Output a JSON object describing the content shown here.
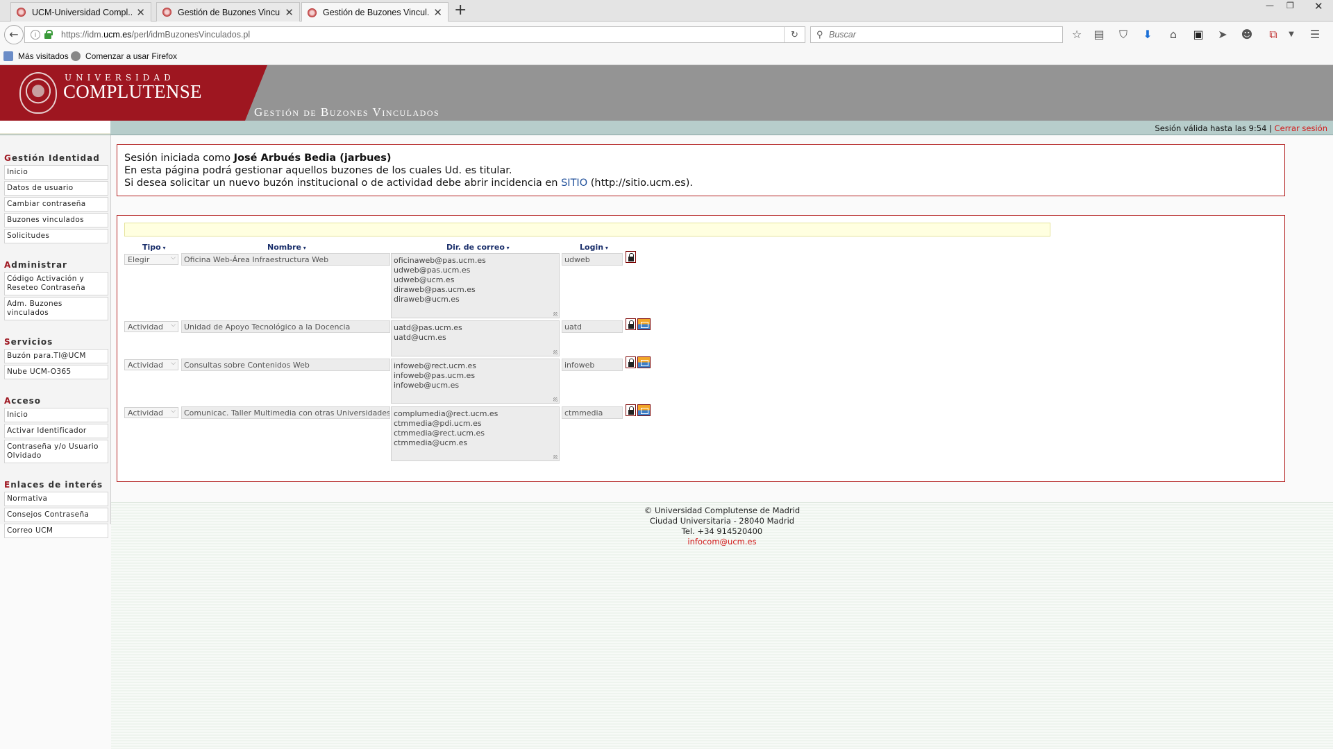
{
  "browser": {
    "tabs": [
      {
        "title": "UCM-Universidad Compl...",
        "active": false
      },
      {
        "title": "Gestión de Buzones Vincul...",
        "active": false
      },
      {
        "title": "Gestión de Buzones Vincul...",
        "active": true
      }
    ],
    "url": {
      "prefix": "https://idm.",
      "domain": "ucm.es",
      "path": "/perl/idmBuzonesVinculados.pl"
    },
    "search_placeholder": "Buscar",
    "bookmarks": [
      "Más visitados",
      "Comenzar a usar Firefox"
    ]
  },
  "header": {
    "logo_top": "UNIVERSIDAD",
    "logo_main": "COMPLUTENSE",
    "app_title": "Gestión de Buzones Vinculados",
    "session_text": "Sesión válida hasta las 9:54 |",
    "logout": "Cerrar sesión"
  },
  "sidebar": [
    {
      "first": "G",
      "rest": "estión Identidad",
      "items": [
        "Inicio",
        "Datos de usuario",
        "Cambiar contraseña",
        "Buzones vinculados",
        "Solicitudes"
      ]
    },
    {
      "first": "A",
      "rest": "dministrar",
      "items": [
        "Código Activación y Reseteo Contraseña",
        "Adm. Buzones vinculados"
      ]
    },
    {
      "first": "S",
      "rest": "ervicios",
      "items": [
        "Buzón para.TI@UCM",
        "Nube UCM-O365"
      ]
    },
    {
      "first": "A",
      "rest": "cceso",
      "items": [
        "Inicio",
        "Activar Identificador",
        "Contraseña y/o Usuario Olvidado"
      ]
    },
    {
      "first": "E",
      "rest": "nlaces de interés",
      "items": [
        "Normativa",
        "Consejos Contraseña",
        "Correo UCM"
      ]
    }
  ],
  "info": {
    "line1_prefix": "Sesión iniciada como ",
    "line1_user": "José Arbués Bedia (jarbues)",
    "line2": "En esta página podrá gestionar aquellos buzones de los cuales Ud. es titular.",
    "line3_prefix": "Si desea solicitar un nuevo buzón institucional o de actividad debe abrir incidencia en ",
    "line3_link": "SITIO",
    "line3_suffix": " (http://sitio.ucm.es)."
  },
  "table": {
    "headers": {
      "tipo": "Tipo",
      "nombre": "Nombre",
      "correo": "Dir. de correo",
      "login": "Login"
    },
    "rows": [
      {
        "tipo": "Elegir",
        "nombre": "Oficina Web-Área Infraestructura Web",
        "correos": [
          "oficinaweb@pas.ucm.es",
          "udweb@pas.ucm.es",
          "udweb@ucm.es",
          "diraweb@pas.ucm.es",
          "diraweb@ucm.es"
        ],
        "login": "udweb",
        "has_mail_icon": false
      },
      {
        "tipo": "Actividad",
        "nombre": "Unidad de Apoyo Tecnológico a la Docencia",
        "correos": [
          "uatd@pas.ucm.es",
          "uatd@ucm.es"
        ],
        "login": "uatd",
        "has_mail_icon": true
      },
      {
        "tipo": "Actividad",
        "nombre": "Consultas sobre Contenidos Web",
        "correos": [
          "infoweb@rect.ucm.es",
          "infoweb@pas.ucm.es",
          "infoweb@ucm.es"
        ],
        "login": "infoweb",
        "has_mail_icon": true
      },
      {
        "tipo": "Actividad",
        "nombre": "Comunicac. Taller Multimedia con otras Universidades",
        "correos": [
          "complumedia@rect.ucm.es",
          "ctmmedia@pdi.ucm.es",
          "ctmmedia@rect.ucm.es",
          "ctmmedia@ucm.es"
        ],
        "login": "ctmmedia",
        "has_mail_icon": true
      }
    ]
  },
  "footer": {
    "copyright": "© Universidad Complutense de Madrid",
    "address": "Ciudad Universitaria - 28040 Madrid",
    "phone": "Tel. +34 914520400",
    "email": "infocom@ucm.es"
  }
}
